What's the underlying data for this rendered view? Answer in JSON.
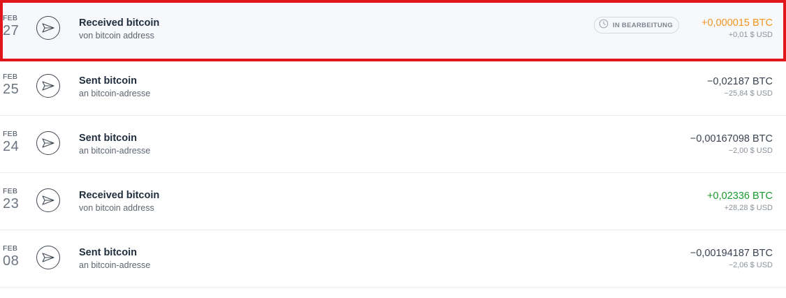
{
  "transactions": [
    {
      "month": "FEB",
      "day": "27",
      "title": "Received bitcoin",
      "subtitle": "von bitcoin address",
      "status": "IN BEARBEITUNG",
      "crypto": "+0,000015 BTC",
      "fiat": "+0,01 $ USD",
      "crypto_color": "#f0961e",
      "icon": "send-icon",
      "highlighted": true
    },
    {
      "month": "FEB",
      "day": "25",
      "title": "Sent bitcoin",
      "subtitle": "an bitcoin-adresse",
      "crypto": "−0,02187 BTC",
      "fiat": "−25,84 $ USD",
      "crypto_color": "#3a4250",
      "icon": "send-icon"
    },
    {
      "month": "FEB",
      "day": "24",
      "title": "Sent bitcoin",
      "subtitle": "an bitcoin-adresse",
      "crypto": "−0,00167098 BTC",
      "fiat": "−2,00 $ USD",
      "crypto_color": "#3a4250",
      "icon": "send-icon"
    },
    {
      "month": "FEB",
      "day": "23",
      "title": "Received bitcoin",
      "subtitle": "von bitcoin address",
      "crypto": "+0,02336 BTC",
      "fiat": "+28,28 $ USD",
      "crypto_color": "#1a9a2e",
      "icon": "send-icon"
    },
    {
      "month": "FEB",
      "day": "08",
      "title": "Sent bitcoin",
      "subtitle": "an bitcoin-adresse",
      "crypto": "−0,00194187 BTC",
      "fiat": "−2,06 $ USD",
      "crypto_color": "#3a4250",
      "icon": "send-icon"
    }
  ],
  "colors": {
    "highlight_border": "#e1161c",
    "pending_amount": "#f0961e",
    "received_amount": "#1a9a2e",
    "sent_amount": "#3a4250"
  }
}
